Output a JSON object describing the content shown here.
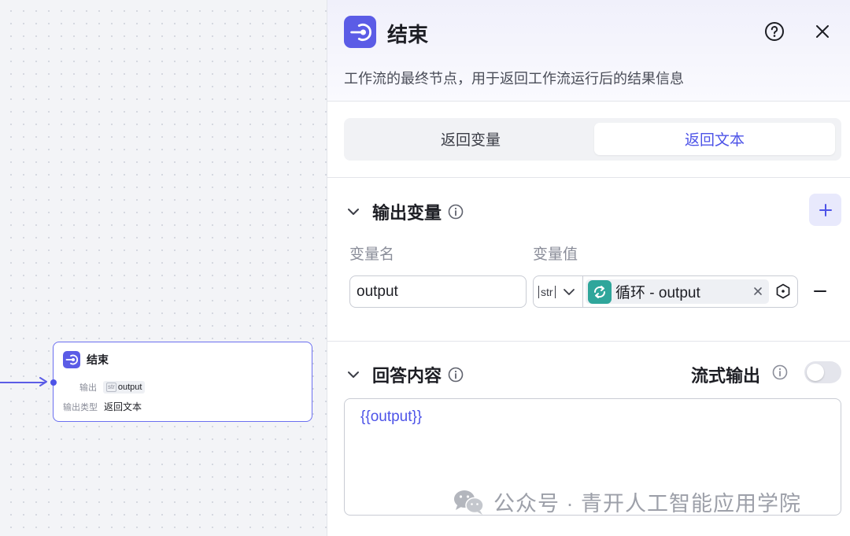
{
  "canvas": {
    "node": {
      "title": "结束",
      "output_label": "输出",
      "output_type": "str",
      "output_value": "output",
      "type_label": "输出类型",
      "type_value": "返回文本"
    }
  },
  "panel": {
    "title": "结束",
    "description": "工作流的最终节点，用于返回工作流运行后的结果信息",
    "tabs": [
      {
        "label": "返回变量",
        "active": false
      },
      {
        "label": "返回文本",
        "active": true
      }
    ],
    "output_section": {
      "title": "输出变量",
      "col_name": "变量名",
      "col_value": "变量值",
      "row": {
        "name": "output",
        "type": "str",
        "ref_source": "循环",
        "ref_separator": " - ",
        "ref_var": "output"
      }
    },
    "answer_section": {
      "title": "回答内容",
      "stream_label": "流式输出",
      "stream_enabled": false,
      "content": "{{output}}"
    }
  },
  "watermark": {
    "text": "公众号 · 青开人工智能应用学院"
  },
  "colors": {
    "accent": "#4d53e8",
    "loop_icon": "#2fa69b"
  }
}
